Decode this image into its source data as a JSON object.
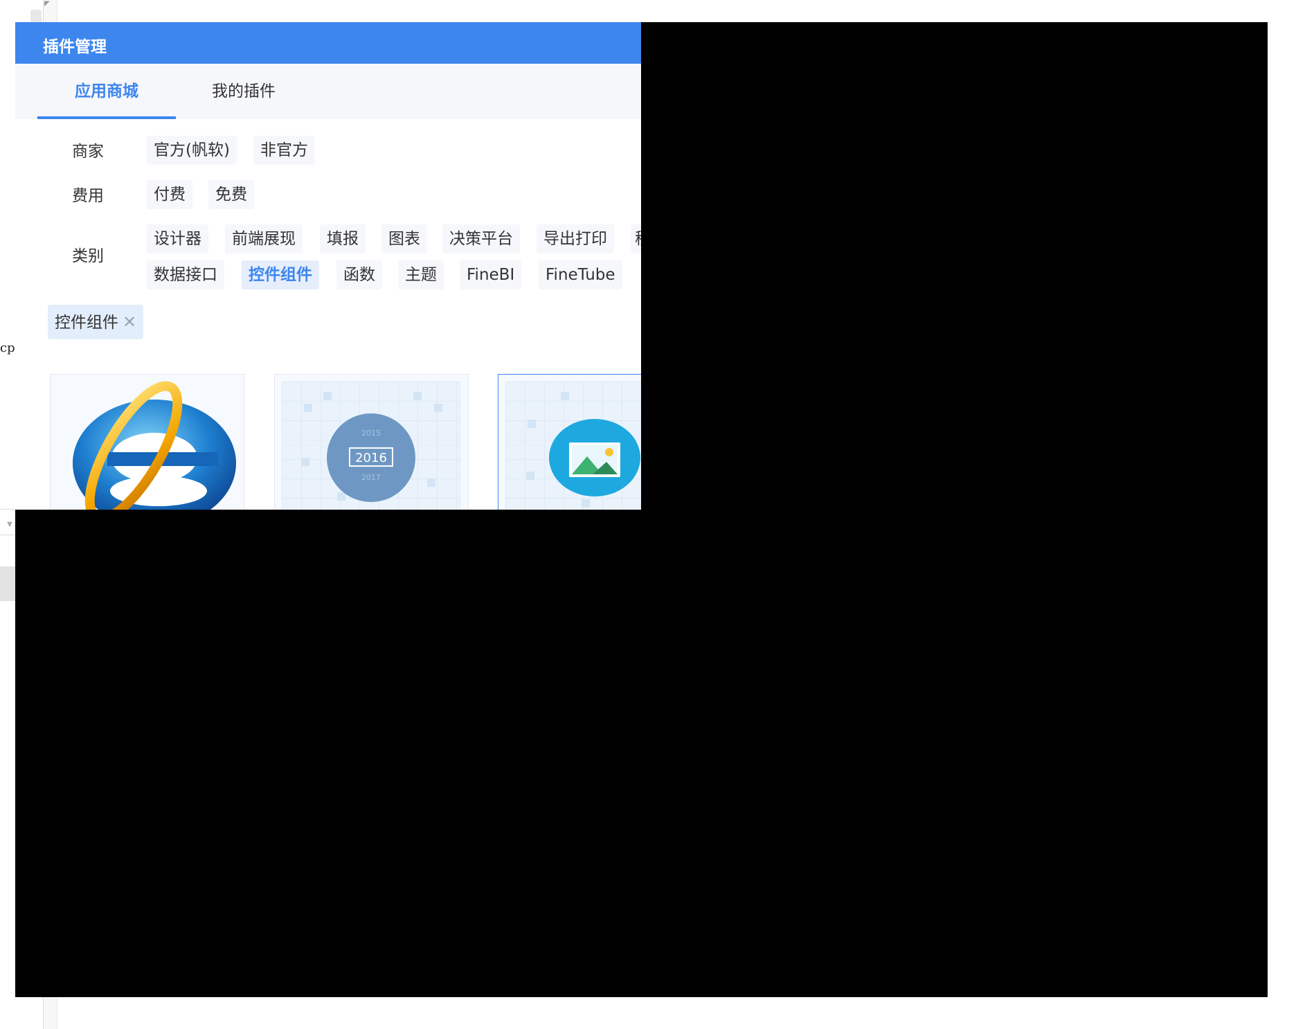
{
  "background": {
    "code_fragment": "cp'"
  },
  "dialog": {
    "title": "插件管理",
    "tabs": [
      {
        "label": "应用商城",
        "active": true
      },
      {
        "label": "我的插件",
        "active": false
      }
    ],
    "filters": {
      "vendor": {
        "label": "商家",
        "options": [
          "官方(帆软)",
          "非官方"
        ]
      },
      "cost": {
        "label": "费用",
        "options": [
          "付费",
          "免费"
        ]
      },
      "category": {
        "label": "类别",
        "row1": [
          "设计器",
          "前端展现",
          "填报",
          "图表",
          "决策平台",
          "导出打印",
          "移"
        ],
        "row2": [
          "数据接口",
          "控件组件",
          "函数",
          "主题",
          "FineBI",
          "FineTube"
        ],
        "selected": "控件组件"
      }
    },
    "selected_tag": {
      "label": "控件组件",
      "close_icon": "close-icon"
    },
    "cards": [
      {
        "icon": "internet-explorer-icon"
      },
      {
        "icon": "date-picker-icon",
        "years": [
          "2015",
          "2016",
          "2017"
        ]
      },
      {
        "icon": "image-icon"
      }
    ]
  },
  "colors": {
    "accent": "#3d86ee",
    "tab_bar": "#f5f7fb",
    "redaction": "#000000"
  }
}
